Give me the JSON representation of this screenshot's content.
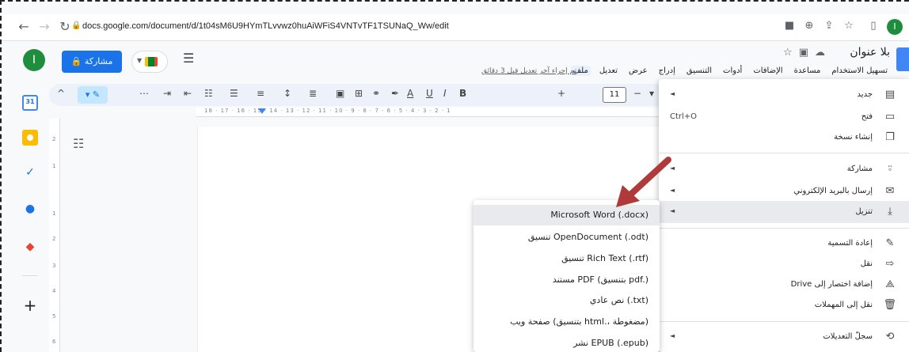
{
  "browser": {
    "url": "docs.google.com/document/d/1t04sM6U9HYmTLvvwz0huAiWFiS4VNTvTF1TSUNaQ_Ww/edit",
    "profile_initial": "I"
  },
  "header": {
    "avatar_initial": "I",
    "share_label": "مشاركة",
    "doc_title": "بلا عنوان",
    "last_edit": "تم إجراء آخر تعديل قبل 3 دقائق",
    "menus": [
      "ملف",
      "تعديل",
      "عرض",
      "إدراج",
      "التنسيق",
      "أدوات",
      "الإضافات",
      "مساعدة",
      "تسهيل الاستخدام"
    ]
  },
  "toolbar": {
    "font_size": "11"
  },
  "ruler": {
    "ticks": "18 · 17 · 16 · 15 · 14 · 13 · 12 · 11 · 10 · 9 · 8 · 7 · 6 · 5 · 4 · 3 · 2 · 1"
  },
  "vruler": {
    "ticks": [
      "2",
      "1",
      "1",
      "2",
      "3",
      "4",
      "5",
      "6"
    ]
  },
  "file_menu": {
    "items": [
      {
        "label": "جديد",
        "icon": "doc-icon",
        "shortcut": "",
        "submenu": true
      },
      {
        "label": "فتح",
        "icon": "folder-icon",
        "shortcut": "Ctrl+O",
        "submenu": false
      },
      {
        "label": "إنشاء نسخة",
        "icon": "copy-icon",
        "shortcut": "",
        "submenu": false
      },
      {
        "label": "مشاركة",
        "icon": "person-add-icon",
        "shortcut": "",
        "submenu": true
      },
      {
        "label": "إرسال بالبريد الإلكتروني",
        "icon": "mail-icon",
        "shortcut": "",
        "submenu": true
      },
      {
        "label": "تنزيل",
        "icon": "download-icon",
        "shortcut": "",
        "submenu": true
      },
      {
        "label": "إعادة التسمية",
        "icon": "rename-icon",
        "shortcut": "",
        "submenu": false
      },
      {
        "label": "نقل",
        "icon": "move-icon",
        "shortcut": "",
        "submenu": false
      },
      {
        "label": "إضافة اختصار إلى Drive",
        "icon": "drive-shortcut-icon",
        "shortcut": "",
        "submenu": false
      },
      {
        "label": "نقل إلى المهملات",
        "icon": "trash-icon",
        "shortcut": "",
        "submenu": false
      },
      {
        "label": "سجلّ التعديلات",
        "icon": "history-icon",
        "shortcut": "",
        "submenu": true
      }
    ]
  },
  "download_menu": {
    "items": [
      "Microsoft Word (.docx)",
      "تنسيق OpenDocument (.odt)",
      "تنسيق Rich Text (.rtf)",
      "مستند PDF (بتنسيق pdf.)",
      "نص عادي (.txt)",
      "صفحة ويب (بتنسيق html.، مضغوطة)",
      "نشر EPUB (.epub)"
    ]
  },
  "colors": {
    "accent": "#1a73e8",
    "annotation_arrow": "#b03a3a"
  }
}
